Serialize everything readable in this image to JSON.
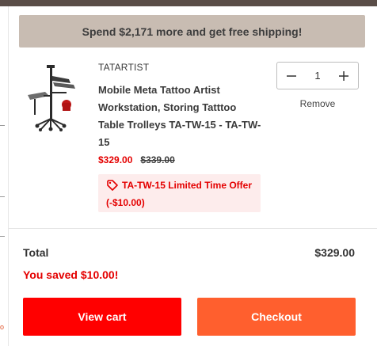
{
  "banner": {
    "text": "Spend $2,171 more and get free shipping!"
  },
  "cart_item": {
    "image_alt_icon": "tattoo-workstation-product-image",
    "vendor": "TATARTIST",
    "title": "Mobile Meta Tattoo Artist Workstation, Storing Tatttoo Table Trolleys TA-TW-15 - TA-TW-15",
    "price_sale": "$329.00",
    "price_compare": "$339.00",
    "discount": "TA-TW-15 Limited Time Offer (-$10.00)",
    "quantity": "1",
    "remove_label": "Remove"
  },
  "summary": {
    "total_label": "Total",
    "total_value": "$329.00",
    "saved_text": "You saved $10.00!"
  },
  "actions": {
    "view_cart": "View cart",
    "checkout": "Checkout"
  },
  "backdrop": {
    "partial_text": "o"
  },
  "colors": {
    "banner_bg": "#c8bcb2",
    "sale_red": "#e40000",
    "view_cart_bg": "#ff0000",
    "checkout_bg": "#ff5f2e",
    "discount_bg": "#fdecec"
  }
}
